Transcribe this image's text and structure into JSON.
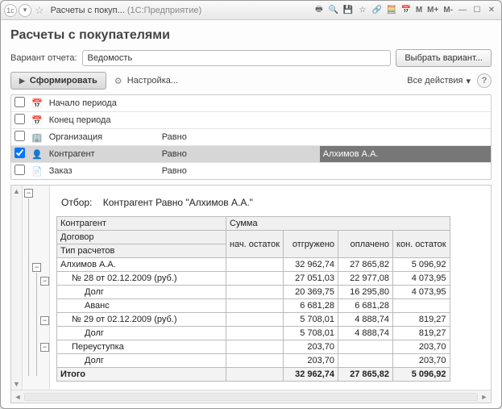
{
  "window": {
    "title_short": "Расчеты с покуп...",
    "app_suffix": "(1С:Предприятие)"
  },
  "page_title": "Расчеты с покупателями",
  "variant": {
    "label": "Вариант отчета:",
    "value": "Ведомость",
    "choose_btn": "Выбрать вариант..."
  },
  "toolbar": {
    "run": "Сформировать",
    "settings": "Настройка...",
    "all_actions": "Все действия"
  },
  "filters": {
    "rows": [
      {
        "checked": false,
        "icon": "calendar-icon",
        "name": "Начало периода",
        "op": "",
        "val": ""
      },
      {
        "checked": false,
        "icon": "calendar-icon",
        "name": "Конец периода",
        "op": "",
        "val": ""
      },
      {
        "checked": false,
        "icon": "org-icon",
        "name": "Организация",
        "op": "Равно",
        "val": ""
      },
      {
        "checked": true,
        "icon": "person-icon",
        "name": "Контрагент",
        "op": "Равно",
        "val": "Алхимов А.А."
      },
      {
        "checked": false,
        "icon": "order-icon",
        "name": "Заказ",
        "op": "Равно",
        "val": ""
      }
    ]
  },
  "report": {
    "filter_label": "Отбор:",
    "filter_text": "Контрагент Равно \"Алхимов А.А.\"",
    "head": {
      "c1": "Контрагент",
      "c2": "Сумма",
      "r2c1": "Договор",
      "r2_nach": "нач. остаток",
      "r2_otg": "отгружено",
      "r2_opl": "оплачено",
      "r2_kon": "кон. остаток",
      "r3c1": "Тип расчетов"
    },
    "rows": [
      {
        "lvl": 0,
        "name": "Алхимов А.А.",
        "nach": "",
        "otg": "32 962,74",
        "opl": "27 865,82",
        "kon": "5 096,92"
      },
      {
        "lvl": 1,
        "name": "№ 28 от 02.12.2009 (руб.)",
        "nach": "",
        "otg": "27 051,03",
        "opl": "22 977,08",
        "kon": "4 073,95"
      },
      {
        "lvl": 2,
        "name": "Долг",
        "nach": "",
        "otg": "20 369,75",
        "opl": "16 295,80",
        "kon": "4 073,95"
      },
      {
        "lvl": 2,
        "name": "Аванс",
        "nach": "",
        "otg": "6 681,28",
        "opl": "6 681,28",
        "kon": ""
      },
      {
        "lvl": 1,
        "name": "№ 29 от 02.12.2009 (руб.)",
        "nach": "",
        "otg": "5 708,01",
        "opl": "4 888,74",
        "kon": "819,27"
      },
      {
        "lvl": 2,
        "name": "Долг",
        "nach": "",
        "otg": "5 708,01",
        "opl": "4 888,74",
        "kon": "819,27"
      },
      {
        "lvl": 1,
        "name": "Переуступка",
        "nach": "",
        "otg": "203,70",
        "opl": "",
        "kon": "203,70"
      },
      {
        "lvl": 2,
        "name": "Долг",
        "nach": "",
        "otg": "203,70",
        "opl": "",
        "kon": "203,70"
      }
    ],
    "total": {
      "name": "Итого",
      "nach": "",
      "otg": "32 962,74",
      "opl": "27 865,82",
      "kon": "5 096,92"
    }
  },
  "titlebar_buttons": {
    "m": "M",
    "mplus": "M+",
    "mminus": "M-"
  }
}
